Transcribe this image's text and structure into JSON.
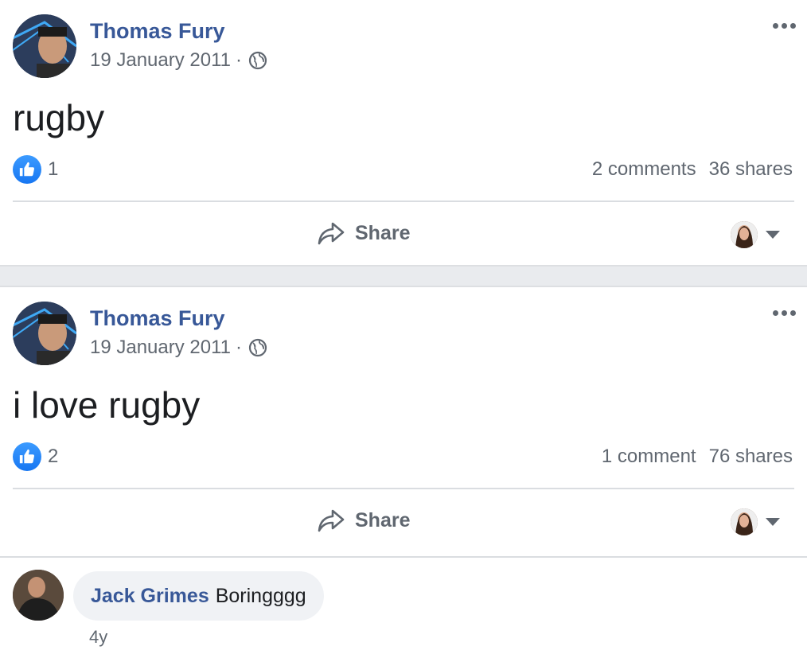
{
  "posts": [
    {
      "author": "Thomas Fury",
      "date": "19 January 2011",
      "separator": "·",
      "text": "rugby",
      "likes": "1",
      "comments": "2 comments",
      "shares": "36 shares",
      "share_label": "Share"
    },
    {
      "author": "Thomas Fury",
      "date": "19 January 2011",
      "separator": "·",
      "text": "i love rugby",
      "likes": "2",
      "comments": "1 comment",
      "shares": "76 shares",
      "share_label": "Share"
    }
  ],
  "comment": {
    "author": "Jack Grimes",
    "text": "Boringggg",
    "time": "4y"
  },
  "icons": {
    "more": "more-options-icon",
    "audience": "globe-icon",
    "like": "like-thumb-icon",
    "share": "share-arrow-icon",
    "caret": "caret-down-icon"
  },
  "colors": {
    "link": "#385898",
    "secondary_text": "#606770",
    "like_blue": "#1877f2",
    "divider": "#dadde1",
    "feed_bg": "#e9ebee",
    "comment_bubble": "#f0f2f5"
  }
}
